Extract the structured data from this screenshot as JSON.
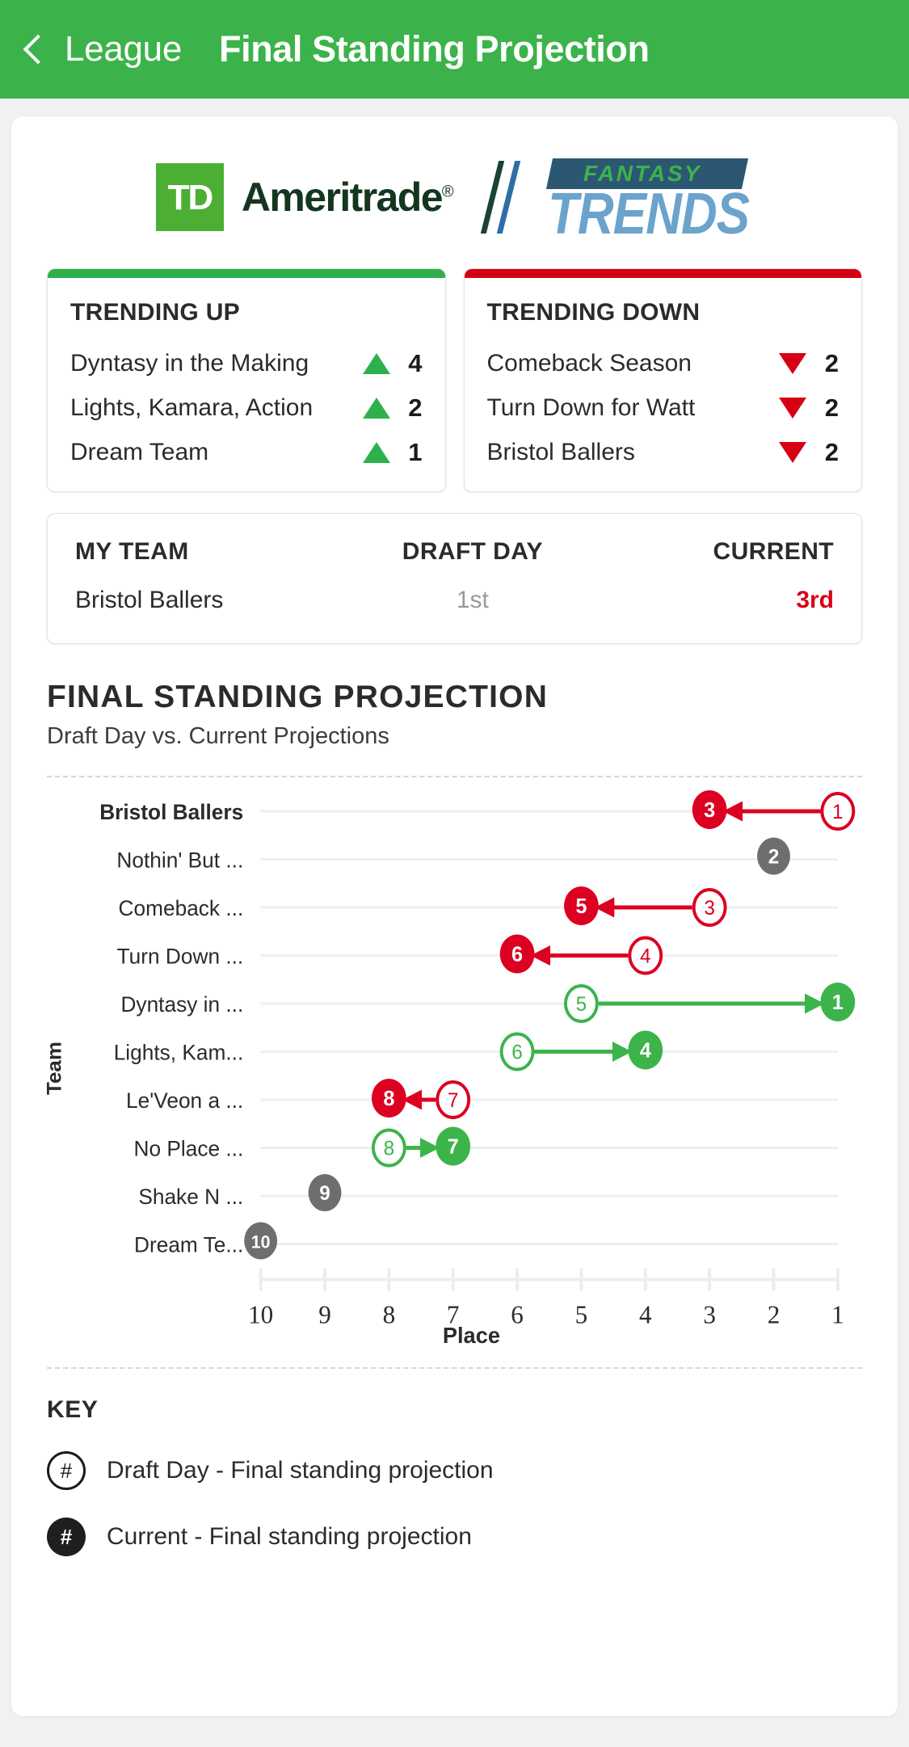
{
  "navbar": {
    "back_label": "League",
    "title": "Final Standing Projection",
    "bg_color": "#3cb34a"
  },
  "logos": {
    "td": {
      "mark": "TD",
      "word": "Ameritrade",
      "reg": "®"
    },
    "fantasy_trends": {
      "top": "FANTASY",
      "bottom": "TRENDS"
    }
  },
  "trending_up": {
    "heading": "TRENDING UP",
    "accent": "#2eb14a",
    "items": [
      {
        "name": "Dyntasy in the Making",
        "value": "4",
        "dir": "up"
      },
      {
        "name": "Lights, Kamara, Action",
        "value": "2",
        "dir": "up"
      },
      {
        "name": "Dream Team",
        "value": "1",
        "dir": "up"
      }
    ]
  },
  "trending_down": {
    "heading": "TRENDING DOWN",
    "accent": "#d60014",
    "items": [
      {
        "name": "Comeback Season",
        "value": "2",
        "dir": "down"
      },
      {
        "name": "Turn Down for Watt",
        "value": "2",
        "dir": "down"
      },
      {
        "name": "Bristol Ballers",
        "value": "2",
        "dir": "down"
      }
    ]
  },
  "my_team": {
    "col1_head": "MY TEAM",
    "col2_head": "DRAFT DAY",
    "col3_head": "CURRENT",
    "team": "Bristol Ballers",
    "draft_day": "1st",
    "current": "3rd",
    "current_color": "#d60014"
  },
  "section": {
    "title": "FINAL STANDING PROJECTION",
    "subtitle": "Draft Day vs. Current Projections"
  },
  "chart_data": {
    "type": "scatter",
    "title": "FINAL STANDING PROJECTION",
    "subtitle": "Draft Day vs. Current Projections",
    "xlabel": "Place",
    "ylabel": "Team",
    "xticks": [
      10,
      9,
      8,
      7,
      6,
      5,
      4,
      3,
      2,
      1
    ],
    "xlim": [
      10,
      1
    ],
    "x_axis_reversed": true,
    "grid": true,
    "legend_position": "below",
    "series_names": [
      "Draft Day - Final standing projection",
      "Current - Final standing projection"
    ],
    "colors": {
      "up": "#3cb44a",
      "down": "#dc0021",
      "neutral": "#6e6e6e"
    },
    "categories": [
      "Bristol Ballers",
      "Nothin' But ...",
      "Comeback ...",
      "Turn Down ...",
      "Dyntasy in ...",
      "Lights, Kam...",
      "Le'Veon a  ...",
      "No Place ...",
      "Shake N ...",
      "Dream Te..."
    ],
    "rows": [
      {
        "team": "Bristol Ballers",
        "draft": 1,
        "current": 3,
        "dir": "down",
        "highlight": true
      },
      {
        "team": "Nothin' But ...",
        "draft": 2,
        "current": 2,
        "dir": "neutral",
        "highlight": false
      },
      {
        "team": "Comeback ...",
        "draft": 3,
        "current": 5,
        "dir": "down",
        "highlight": false
      },
      {
        "team": "Turn Down ...",
        "draft": 4,
        "current": 6,
        "dir": "down",
        "highlight": false
      },
      {
        "team": "Dyntasy in ...",
        "draft": 5,
        "current": 1,
        "dir": "up",
        "highlight": false
      },
      {
        "team": "Lights, Kam...",
        "draft": 6,
        "current": 4,
        "dir": "up",
        "highlight": false
      },
      {
        "team": "Le'Veon a  ...",
        "draft": 7,
        "current": 8,
        "dir": "down",
        "highlight": false
      },
      {
        "team": "No Place ...",
        "draft": 8,
        "current": 7,
        "dir": "up",
        "highlight": false
      },
      {
        "team": "Shake N ...",
        "draft": 9,
        "current": 9,
        "dir": "neutral",
        "highlight": false
      },
      {
        "team": "Dream Te...",
        "draft": 10,
        "current": 10,
        "dir": "neutral",
        "highlight": false
      }
    ]
  },
  "key": {
    "title": "KEY",
    "items": [
      {
        "glyph": "#",
        "style": "hollow",
        "label": "Draft Day - Final standing projection"
      },
      {
        "glyph": "#",
        "style": "solid",
        "label": "Current - Final standing projection"
      }
    ]
  }
}
